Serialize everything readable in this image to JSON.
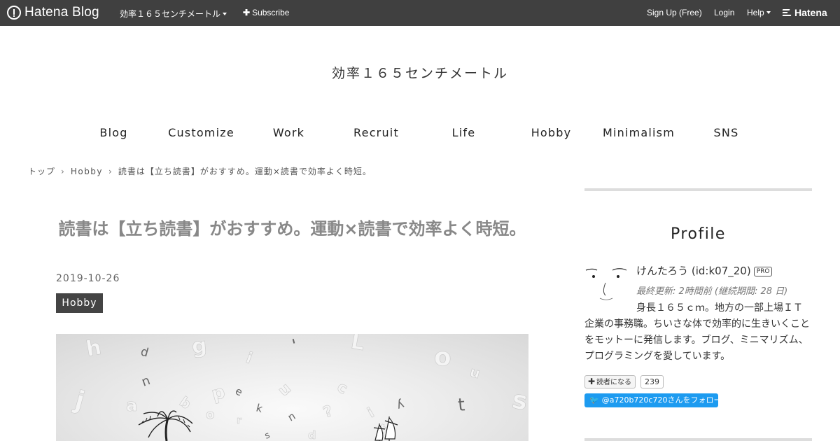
{
  "topbar": {
    "logo_text": "Hatena Blog",
    "blog_menu": "効率１６５センチメートル",
    "subscribe": "Subscribe",
    "signup": "Sign Up (Free)",
    "login": "Login",
    "help": "Help",
    "brand": "Hatena"
  },
  "blog": {
    "title": "効率１６５センチメートル"
  },
  "nav": {
    "items": [
      "Blog",
      "Customize",
      "Work",
      "Recruit",
      "Life",
      "Hobby",
      "Minimalism",
      "SNS"
    ]
  },
  "breadcrumb": {
    "items": [
      "トップ",
      "Hobby",
      "読書は【立ち読書】がおすすめ。運動×読書で効率よく時短。"
    ]
  },
  "article": {
    "title": "読書は【立ち読書】がおすすめ。運動×読書で効率よく時短。",
    "date": "2019-10-26",
    "category": "Hobby",
    "eyecatch_letters": [
      "h",
      "d",
      "g",
      "i",
      "'",
      "L",
      "o",
      "t",
      "j",
      "a",
      "n",
      "b",
      "p",
      "e",
      "u",
      "c",
      "n",
      "o",
      "r",
      "k",
      "?",
      "i",
      "y",
      "s",
      "t",
      "s",
      "d",
      "u"
    ]
  },
  "sidebar": {
    "profile_heading": "Profile",
    "profile_name": "けんたろう (id:k07_20)",
    "pro_badge": "PRO",
    "profile_meta": "最終更新: 2時間前 (継続期間: 28 日)",
    "profile_desc": "身長１６５ｃｍ。地方の一部上場ＩＴ企業の事務職。ちいさな体で効率的に生きいくことをモットーに発信します。ブログ、ミニマリズム、プログラミングを愛しています。",
    "subscribe_label": "読者になる",
    "subscribe_count": "239",
    "follow_label": "@a720b720c720さんをフォロー"
  },
  "colors": {
    "topbar": "#404040",
    "badge": "#444444",
    "title_gray": "#888888",
    "twitter": "#1d9bf0",
    "rule": "#dddddd"
  }
}
